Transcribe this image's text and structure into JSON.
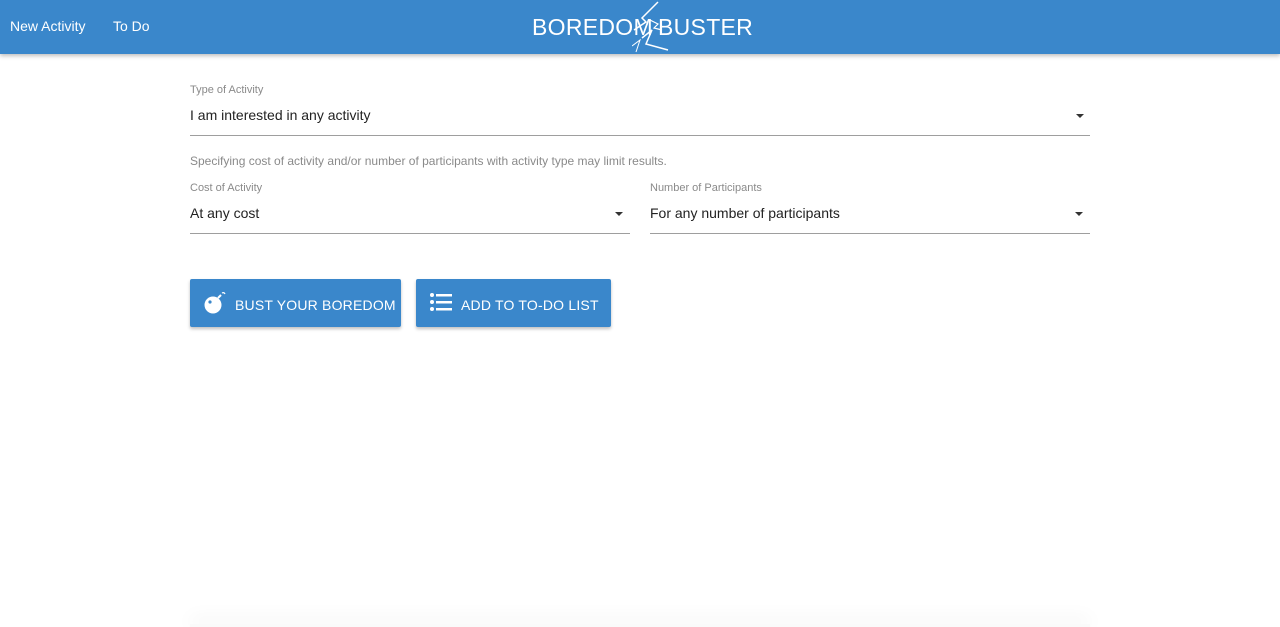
{
  "nav": {
    "new_activity": "New Activity",
    "todo": "To Do"
  },
  "logo": {
    "left": "BOREDOM",
    "right": "BUSTER"
  },
  "form": {
    "type": {
      "label": "Type of Activity",
      "value": "I am interested in any activity"
    },
    "hint": "Specifying cost of activity and/or number of participants with activity type may limit results.",
    "cost": {
      "label": "Cost of Activity",
      "value": "At any cost"
    },
    "participants": {
      "label": "Number of Participants",
      "value": "For any number of participants"
    }
  },
  "buttons": {
    "bust": "BUST YOUR BOREDOM",
    "add": "ADD TO TO-DO LIST"
  },
  "colors": {
    "primary": "#3a87cb"
  },
  "icons": {
    "bust": "bomb-icon",
    "add": "list-icon",
    "dropdown": "caret-down-icon"
  }
}
